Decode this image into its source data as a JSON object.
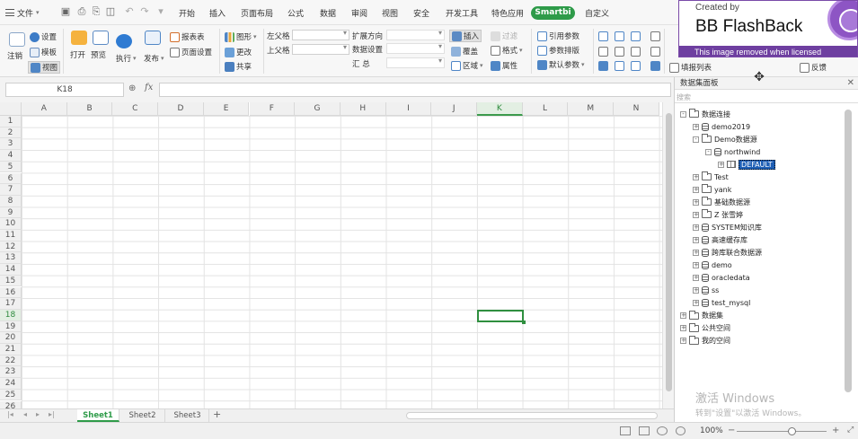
{
  "menubar": {
    "file_label": "文件",
    "tabs": [
      "开始",
      "插入",
      "页面布局",
      "公式",
      "数据",
      "审阅",
      "视图",
      "安全",
      "开发工具",
      "特色应用",
      "Smartbi",
      "自定义"
    ]
  },
  "ribbon": {
    "logout": "注销",
    "settings": "设置",
    "template": "模板",
    "view": "视图",
    "open": "打开",
    "preview": "预览",
    "execute": "执行",
    "publish": "发布",
    "report_form": "报表表",
    "page_setup": "页面设置",
    "graph": "图形",
    "update": "更改",
    "share": "共享",
    "left_parent": "左父格",
    "top_parent": "上父格",
    "expand_dir": "扩展方向",
    "data_setting": "数据设置",
    "summary": "汇  总",
    "insert": "插入",
    "overwrite": "覆盖",
    "region": "区域",
    "filter": "过滤",
    "format": "格式",
    "attribute": "属性",
    "ref_param": "引用参数",
    "param_order": "参数排版",
    "default_param": "默认参数",
    "fill_list": "填报列表",
    "reverse": "反馈"
  },
  "formula_bar": {
    "name_box": "K18",
    "fx": "fx"
  },
  "grid": {
    "columns": [
      "A",
      "B",
      "C",
      "D",
      "E",
      "F",
      "G",
      "H",
      "I",
      "J",
      "K",
      "L",
      "M",
      "N"
    ],
    "rows": [
      "1",
      "2",
      "3",
      "4",
      "5",
      "6",
      "7",
      "8",
      "9",
      "10",
      "11",
      "12",
      "13",
      "14",
      "15",
      "16",
      "17",
      "18",
      "19",
      "20",
      "21",
      "22",
      "23",
      "24",
      "25",
      "26"
    ],
    "selected_col": "K",
    "selected_row": "18"
  },
  "sheets": [
    "Sheet1",
    "Sheet2",
    "Sheet3"
  ],
  "active_sheet": "Sheet1",
  "status": {
    "zoom": "100%"
  },
  "panel": {
    "title": "数据集面板",
    "search_placeholder": "搜索",
    "tree": [
      {
        "label": "数据连接",
        "level": 0,
        "pm": "-",
        "icon": "folder"
      },
      {
        "label": "demo2019",
        "level": 1,
        "pm": "+",
        "icon": "db"
      },
      {
        "label": "Demo数据源",
        "level": 1,
        "pm": "-",
        "icon": "folder"
      },
      {
        "label": "northwind",
        "level": 2,
        "pm": "-",
        "icon": "db"
      },
      {
        "label": "DEFAULT",
        "level": 3,
        "pm": "+",
        "icon": "tbl"
      },
      {
        "label": "Test",
        "level": 1,
        "pm": "+",
        "icon": "folder"
      },
      {
        "label": "yank",
        "level": 1,
        "pm": "+",
        "icon": "folder"
      },
      {
        "label": "基础数据源",
        "level": 1,
        "pm": "+",
        "icon": "folder"
      },
      {
        "label": "Z 张雪婷",
        "level": 1,
        "pm": "+",
        "icon": "folder"
      },
      {
        "label": "SYSTEM知识库",
        "level": 1,
        "pm": "+",
        "icon": "db"
      },
      {
        "label": "高速缓存库",
        "level": 1,
        "pm": "+",
        "icon": "db"
      },
      {
        "label": "跨库联合数据源",
        "level": 1,
        "pm": "+",
        "icon": "db"
      },
      {
        "label": "demo",
        "level": 1,
        "pm": "+",
        "icon": "db"
      },
      {
        "label": "oracledata",
        "level": 1,
        "pm": "+",
        "icon": "db"
      },
      {
        "label": "ss",
        "level": 1,
        "pm": "+",
        "icon": "db"
      },
      {
        "label": "test_mysql",
        "level": 1,
        "pm": "+",
        "icon": "db"
      },
      {
        "label": "数据集",
        "level": 0,
        "pm": "+",
        "icon": "folder"
      },
      {
        "label": "公共空间",
        "level": 0,
        "pm": "+",
        "icon": "folder"
      },
      {
        "label": "我的空间",
        "level": 0,
        "pm": "+",
        "icon": "folder"
      }
    ],
    "activation_line1": "激活 Windows",
    "activation_line2": "转到\"设置\"以激活 Windows。"
  },
  "watermark": {
    "created_by": "Created by",
    "title": "BB FlashBack",
    "strip": "This image removed when licensed"
  }
}
